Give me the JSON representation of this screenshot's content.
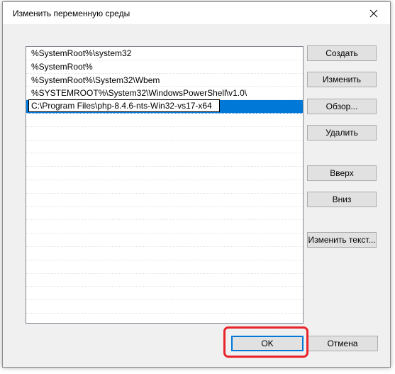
{
  "dialog": {
    "title": "Изменить переменную среды",
    "close_icon": "close-icon"
  },
  "list": {
    "items": [
      "%SystemRoot%\\system32",
      "%SystemRoot%",
      "%SystemRoot%\\System32\\Wbem",
      "%SYSTEMROOT%\\System32\\WindowsPowerShell\\v1.0\\"
    ],
    "editing_value": "C:\\Program Files\\php-8.4.6-nts-Win32-vs17-x64"
  },
  "buttons": {
    "create": "Создать",
    "edit": "Изменить",
    "browse": "Обзор...",
    "delete": "Удалить",
    "up": "Вверх",
    "down": "Вниз",
    "edit_text": "Изменить текст...",
    "ok": "OK",
    "cancel": "Отмена"
  },
  "colors": {
    "selection": "#0078d7",
    "highlight_box": "#e8232a"
  }
}
